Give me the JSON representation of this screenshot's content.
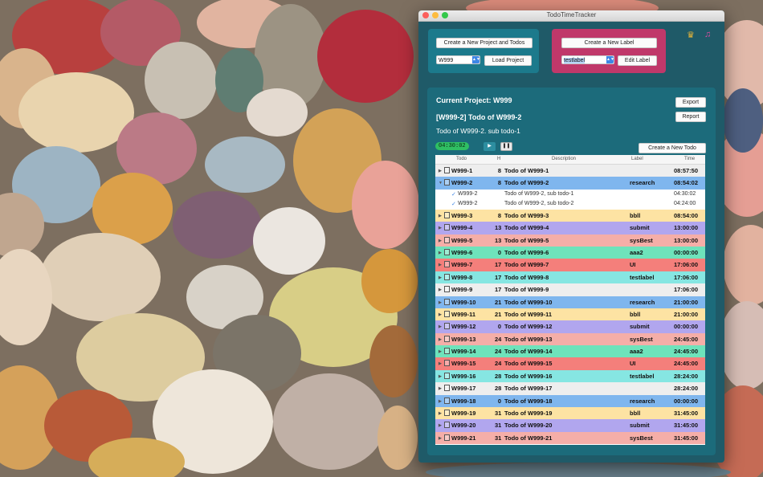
{
  "window": {
    "title": "TodoTimeTracker",
    "dot_colors": [
      "#fc605c",
      "#fdbc40",
      "#34c84a"
    ]
  },
  "project_panel": {
    "create_button": "Create a New Project and Todos",
    "project_select": "W999",
    "load_button": "Load Project",
    "color": "#1c7a8c"
  },
  "label_panel": {
    "create_button": "Create a New Label",
    "label_select": "testlabel",
    "edit_button": "Edit Label",
    "color": "#c0386a"
  },
  "icons": {
    "crown": "crown-icon",
    "music": "music-note-icon"
  },
  "main": {
    "current_project": "Current Project: W999",
    "todo_title": "[W999-2] Todo of W999-2",
    "sub_title": "Todo of W999-2. sub todo-1",
    "export_button": "Export",
    "report_button": "Report",
    "timer": "04:30:02",
    "create_todo_button": "Create a New Todo"
  },
  "table": {
    "headers": {
      "todo": "Todo",
      "h": "H",
      "description": "Description",
      "label": "Label",
      "time": "Time"
    },
    "rows": [
      {
        "todo": "W999-1",
        "h": "8",
        "desc": "Todo of W999-1",
        "label": "",
        "time": "08:57:50",
        "color": "#eeeeee"
      },
      {
        "todo": "W999-2",
        "h": "8",
        "desc": "Todo of W999-2",
        "label": "research",
        "time": "08:54:02",
        "color": "#7fb6ee",
        "expanded": true,
        "subs": [
          {
            "todo": "W999-2",
            "desc": "Todo of W999-2, sub todo-1",
            "time": "04:30:02"
          },
          {
            "todo": "W999-2",
            "desc": "Todo of W999-2, sub todo-2",
            "time": "04:24:00"
          }
        ]
      },
      {
        "todo": "W999-3",
        "h": "8",
        "desc": "Todo of W999-3",
        "label": "bbll",
        "time": "08:54:00",
        "color": "#fde3a3"
      },
      {
        "todo": "W999-4",
        "h": "13",
        "desc": "Todo of W999-4",
        "label": "submit",
        "time": "13:00:00",
        "color": "#b1a6ee"
      },
      {
        "todo": "W999-5",
        "h": "13",
        "desc": "Todo of W999-5",
        "label": "sysBest",
        "time": "13:00:00",
        "color": "#f5aea8"
      },
      {
        "todo": "W999-6",
        "h": "0",
        "desc": "Todo of W999-6",
        "label": "aaa2",
        "time": "00:00:00",
        "color": "#6ee3bb"
      },
      {
        "todo": "W999-7",
        "h": "17",
        "desc": "Todo of W999-7",
        "label": "UI",
        "time": "17:06:00",
        "color": "#f47f7b"
      },
      {
        "todo": "W999-8",
        "h": "17",
        "desc": "Todo of W999-8",
        "label": "testlabel",
        "time": "17:06:00",
        "color": "#86e6e2"
      },
      {
        "todo": "W999-9",
        "h": "17",
        "desc": "Todo of W999-9",
        "label": "",
        "time": "17:06:00",
        "color": "#eeeeee"
      },
      {
        "todo": "W999-10",
        "h": "21",
        "desc": "Todo of W999-10",
        "label": "research",
        "time": "21:00:00",
        "color": "#7fb6ee"
      },
      {
        "todo": "W999-11",
        "h": "21",
        "desc": "Todo of W999-11",
        "label": "bbll",
        "time": "21:00:00",
        "color": "#fde3a3"
      },
      {
        "todo": "W999-12",
        "h": "0",
        "desc": "Todo of W999-12",
        "label": "submit",
        "time": "00:00:00",
        "color": "#b1a6ee"
      },
      {
        "todo": "W999-13",
        "h": "24",
        "desc": "Todo of W999-13",
        "label": "sysBest",
        "time": "24:45:00",
        "color": "#f5aea8"
      },
      {
        "todo": "W999-14",
        "h": "24",
        "desc": "Todo of W999-14",
        "label": "aaa2",
        "time": "24:45:00",
        "color": "#6ee3bb"
      },
      {
        "todo": "W999-15",
        "h": "24",
        "desc": "Todo of W999-15",
        "label": "UI",
        "time": "24:45:00",
        "color": "#f47f7b"
      },
      {
        "todo": "W999-16",
        "h": "28",
        "desc": "Todo of W999-16",
        "label": "testlabel",
        "time": "28:24:00",
        "color": "#86e6e2"
      },
      {
        "todo": "W999-17",
        "h": "28",
        "desc": "Todo of W999-17",
        "label": "",
        "time": "28:24:00",
        "color": "#eeeeee"
      },
      {
        "todo": "W999-18",
        "h": "0",
        "desc": "Todo of W999-18",
        "label": "research",
        "time": "00:00:00",
        "color": "#7fb6ee"
      },
      {
        "todo": "W999-19",
        "h": "31",
        "desc": "Todo of W999-19",
        "label": "bbll",
        "time": "31:45:00",
        "color": "#fde3a3"
      },
      {
        "todo": "W999-20",
        "h": "31",
        "desc": "Todo of W999-20",
        "label": "submit",
        "time": "31:45:00",
        "color": "#b1a6ee"
      },
      {
        "todo": "W999-21",
        "h": "31",
        "desc": "Todo of W999-21",
        "label": "sysBest",
        "time": "31:45:00",
        "color": "#f5aea8"
      }
    ]
  }
}
